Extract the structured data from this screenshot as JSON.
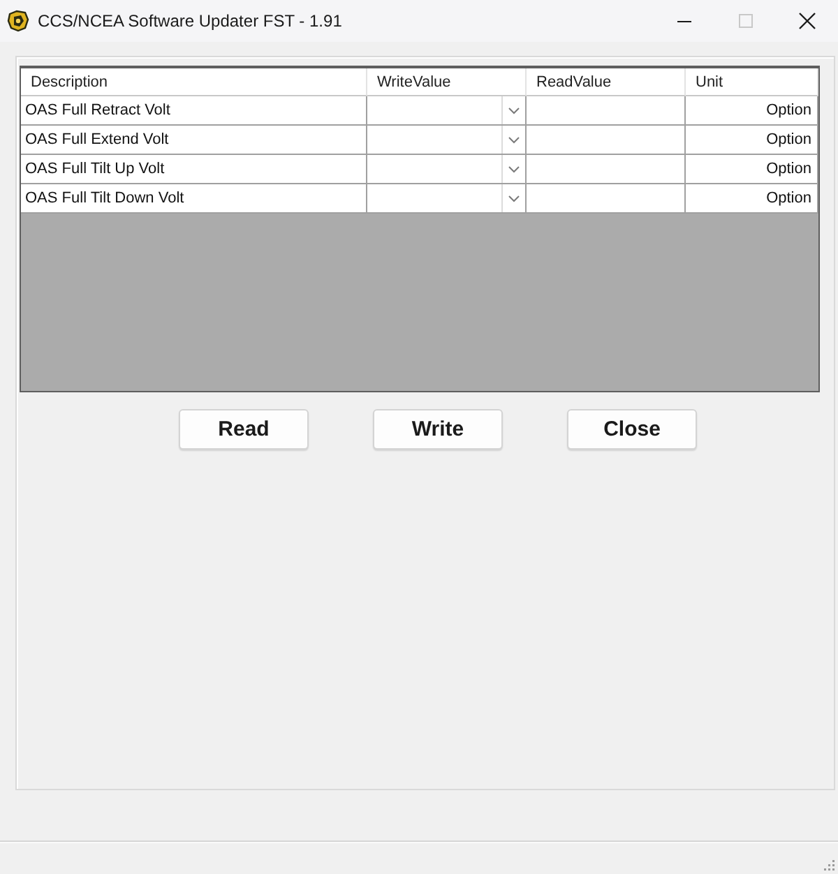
{
  "window": {
    "title": "CCS/NCEA Software Updater FST - 1.91",
    "controls": [
      {
        "kind": "minimize",
        "disabled": false
      },
      {
        "kind": "maximize",
        "disabled": true
      },
      {
        "kind": "close",
        "disabled": false
      }
    ]
  },
  "grid": {
    "columns": [
      {
        "label": "Description",
        "kind": "description"
      },
      {
        "label": "WriteValue",
        "kind": "combo"
      },
      {
        "label": "ReadValue",
        "kind": "readout"
      },
      {
        "label": "Unit",
        "kind": "unit"
      }
    ],
    "rows": [
      {
        "description": "OAS Full Retract Volt",
        "unit": "Option"
      },
      {
        "description": "OAS Full Extend Volt",
        "unit": "Option"
      },
      {
        "description": "OAS Full Tilt Up Volt",
        "unit": "Option"
      },
      {
        "description": "OAS Full Tilt Down Volt",
        "unit": "Option"
      }
    ]
  },
  "buttons": [
    "Read",
    "Write",
    "Close"
  ]
}
